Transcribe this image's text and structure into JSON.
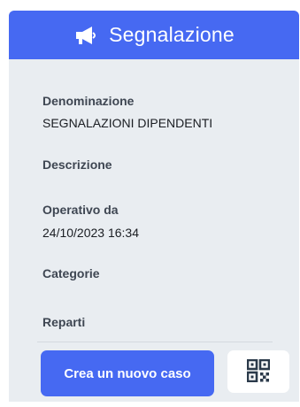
{
  "header": {
    "title": "Segnalazione",
    "icon": "megaphone-icon",
    "color": "#4669f2"
  },
  "fields": [
    {
      "label": "Denominazione",
      "value": "SEGNALAZIONI DIPENDENTI"
    },
    {
      "label": "Descrizione",
      "value": ""
    },
    {
      "label": "Operativo da",
      "value": "24/10/2023 16:34"
    },
    {
      "label": "Categorie",
      "value": ""
    },
    {
      "label": "Reparti",
      "value": ""
    }
  ],
  "actions": {
    "create_label": "Crea un nuovo caso",
    "qr_icon": "qr-code-icon"
  }
}
